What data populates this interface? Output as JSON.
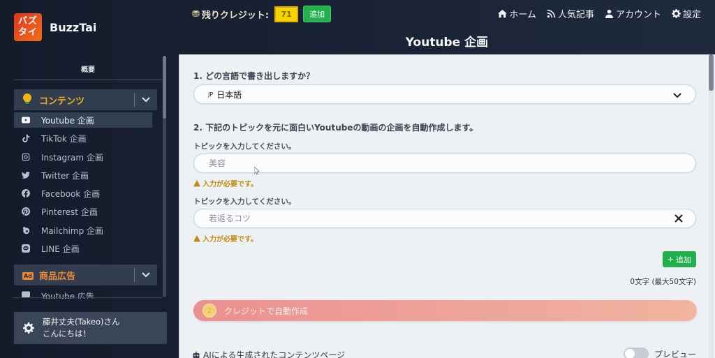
{
  "brand": {
    "logo_line1": "バズ",
    "logo_line2": "タイ",
    "name": "BuzzTai"
  },
  "header": {
    "credits_label": "残りクレジット:",
    "credits_value": "71",
    "add_credits_label": "追加",
    "nav": [
      {
        "icon": "home-icon",
        "label": "ホーム"
      },
      {
        "icon": "rss-icon",
        "label": "人気記事"
      },
      {
        "icon": "user-icon",
        "label": "アカウント"
      },
      {
        "icon": "gear-icon",
        "label": "設定"
      }
    ],
    "page_title": "Youtube 企画"
  },
  "sidebar": {
    "heading": "概要",
    "groups": [
      {
        "label": "コンテンツ",
        "icon": "lightbulb-icon",
        "items": [
          {
            "icon": "youtube-icon",
            "label": "Youtube 企画",
            "active": true
          },
          {
            "icon": "tiktok-icon",
            "label": "TikTok 企画"
          },
          {
            "icon": "instagram-icon",
            "label": "Instagram 企画"
          },
          {
            "icon": "twitter-icon",
            "label": "Twitter 企画"
          },
          {
            "icon": "facebook-icon",
            "label": "Facebook 企画"
          },
          {
            "icon": "pinterest-icon",
            "label": "Pinterest 企画"
          },
          {
            "icon": "mailchimp-icon",
            "label": "Mailchimp 企画"
          },
          {
            "icon": "line-icon",
            "label": "LINE 企画"
          }
        ]
      },
      {
        "label": "商品広告",
        "icon": "ad-icon",
        "badge": "Ad",
        "items": [
          {
            "icon": "youtube-icon",
            "label": "Youtube 広告"
          }
        ]
      }
    ],
    "user": {
      "name": "藤井丈夫(Takeo)さん",
      "greeting": "こんにちは！"
    }
  },
  "main": {
    "q1_label": "1. どの言語で書き出しますか？",
    "language": {
      "flag": "JP",
      "value": "日本語"
    },
    "q2_label": "2. 下記のトピックを元に面白いYoutubeの動画の企画を自動作成します。",
    "topics": [
      {
        "label": "トピックを入力してください。",
        "placeholder": "美容",
        "value": "",
        "warning": "入力が必要です。"
      },
      {
        "label": "トピックを入力してください。",
        "placeholder": "若返るコツ",
        "value": "",
        "warning": "入力が必要です。"
      }
    ],
    "add_topic_label": "追加",
    "char_count": "0文字 (最大50文字)",
    "generate": {
      "cost": "2",
      "label": "クレジットで自動作成"
    },
    "ai_section_title": "AIによる生成されたコンテンツページ",
    "preview_label": "プレビュー",
    "preview_enabled": false
  },
  "colors": {
    "accent_green": "#21b04b",
    "credit_yellow": "#f5d400",
    "content_group": "#f1b514",
    "ads_group": "#ee8a32",
    "warning": "#c08a0e"
  }
}
